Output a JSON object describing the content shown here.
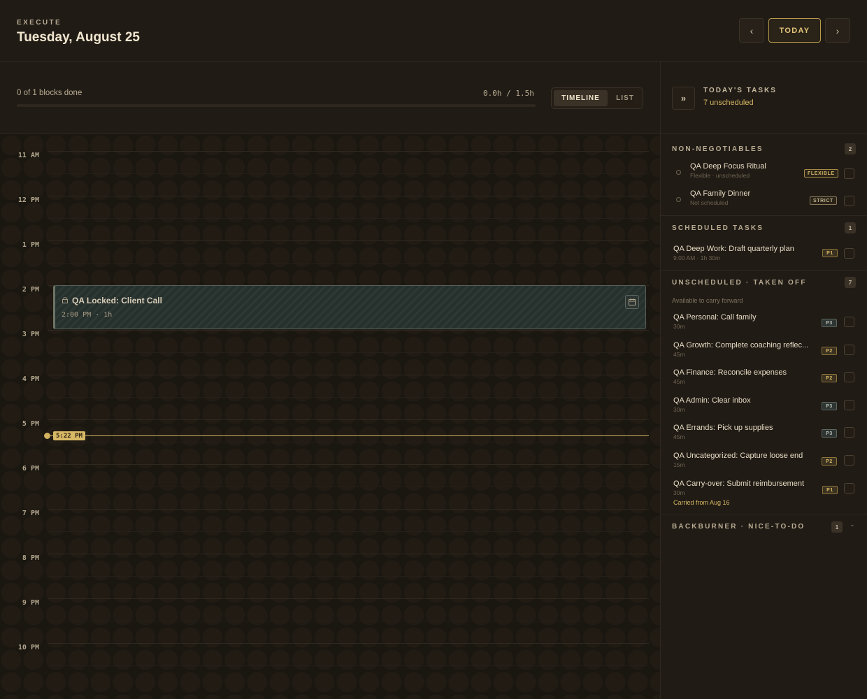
{
  "header": {
    "eyebrow": "EXECUTE",
    "date": "Tuesday, August 25",
    "prev_label": "‹",
    "today_label": "TODAY",
    "next_label": "›"
  },
  "progress": {
    "blocks_done": "0 of 1 blocks done",
    "hours": "0.0h / 1.5h",
    "fraction": 0
  },
  "view_toggle": {
    "timeline": "TIMELINE",
    "list": "LIST",
    "active": "timeline"
  },
  "timeline": {
    "hours": [
      "11 AM",
      "12 PM",
      "1 PM",
      "2 PM",
      "3 PM",
      "4 PM",
      "5 PM",
      "6 PM",
      "7 PM",
      "8 PM",
      "9 PM",
      "10 PM"
    ],
    "block": {
      "title": "QA Locked: Client Call",
      "meta": "2:00 PM · 1h"
    },
    "now": "5:22 PM"
  },
  "sidebar": {
    "collapse_label": "»",
    "title": "TODAY'S TASKS",
    "subtitle": "7 unscheduled",
    "non_negotiables": {
      "title": "NON-NEGOTIABLES",
      "count": "2",
      "items": [
        {
          "title": "QA Deep Focus Ritual",
          "sub": "Flexible · unscheduled",
          "tag": "FLEXIBLE"
        },
        {
          "title": "QA Family Dinner",
          "sub": "Not scheduled",
          "tag": "STRICT"
        }
      ]
    },
    "scheduled": {
      "title": "SCHEDULED TASKS",
      "count": "1",
      "items": [
        {
          "title": "QA Deep Work: Draft quarterly plan",
          "sub": "9:00 AM · 1h 30m",
          "tag": "P1"
        }
      ]
    },
    "unscheduled": {
      "title": "UNSCHEDULED · TAKEN OFF",
      "count": "7",
      "note": "Available to carry forward",
      "items": [
        {
          "title": "QA Personal: Call family",
          "sub": "30m",
          "tag": "P3"
        },
        {
          "title": "QA Growth: Complete coaching reflec...",
          "sub": "45m",
          "tag": "P2"
        },
        {
          "title": "QA Finance: Reconcile expenses",
          "sub": "45m",
          "tag": "P2"
        },
        {
          "title": "QA Admin: Clear inbox",
          "sub": "30m",
          "tag": "P3"
        },
        {
          "title": "QA Errands: Pick up supplies",
          "sub": "45m",
          "tag": "P3"
        },
        {
          "title": "QA Uncategorized: Capture loose end",
          "sub": "15m",
          "tag": "P2"
        },
        {
          "title": "QA Carry-over: Submit reimbursement",
          "sub": "30m",
          "tag": "P1",
          "carry": "Carried from Aug 16"
        }
      ]
    },
    "backburner": {
      "title": "BACKBURNER · NICE-TO-DO",
      "count": "1",
      "chevron": "⌄"
    }
  },
  "colors": {
    "accent": "#d7b865",
    "background": "#1c1812",
    "panel": "#201b15",
    "locked_block": "#26302d"
  }
}
